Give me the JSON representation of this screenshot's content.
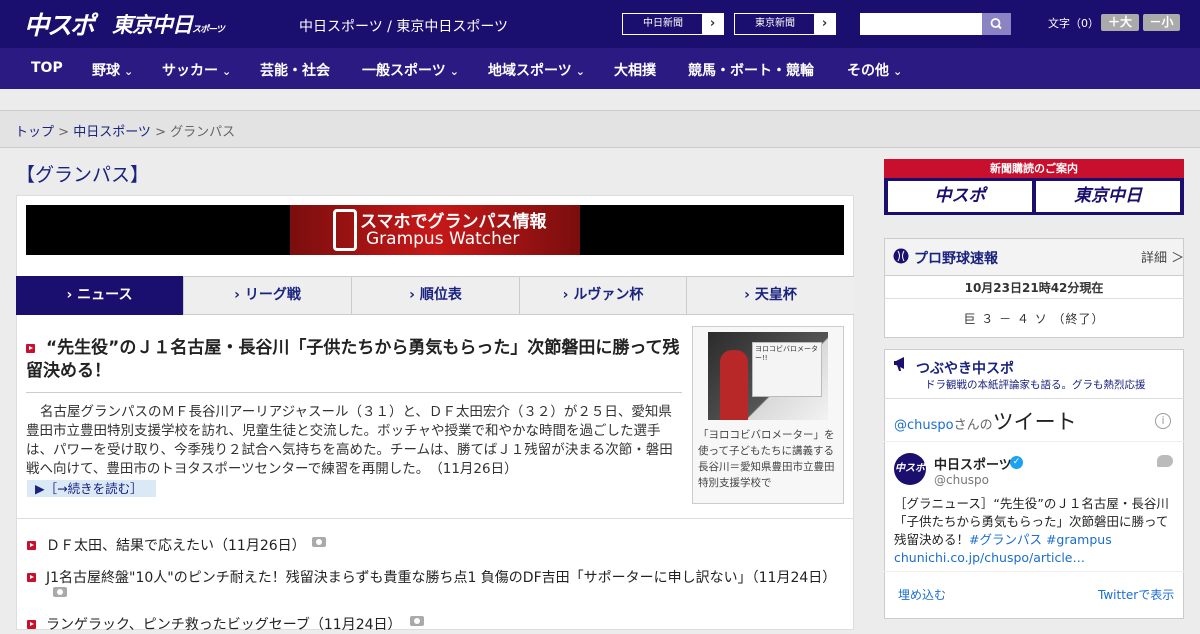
{
  "header": {
    "logo_left": "中スポ",
    "logo_right": "東京中日",
    "logo_right_small": "スポーツ",
    "site_name": "中日スポーツ / 東京中日スポーツ",
    "ext_links": [
      "中日新聞",
      "東京新聞"
    ],
    "search_placeholder": "",
    "font_size_label": "文字（0）",
    "font_bigger": "＋大",
    "font_smaller": "－小",
    "bg_color": "#1a0e6e",
    "nav_color": "#2a1a82"
  },
  "nav": {
    "items": [
      {
        "label": "TOP",
        "dropdown": false
      },
      {
        "label": "野球",
        "dropdown": true
      },
      {
        "label": "サッカー",
        "dropdown": true
      },
      {
        "label": "芸能・社会",
        "dropdown": false
      },
      {
        "label": "一般スポーツ",
        "dropdown": true
      },
      {
        "label": "地域スポーツ",
        "dropdown": true
      },
      {
        "label": "大相撲",
        "dropdown": false
      },
      {
        "label": "競馬・ボート・競輪",
        "dropdown": false
      },
      {
        "label": "その他",
        "dropdown": true
      }
    ],
    "chevron": "⌄"
  },
  "breadcrumb": {
    "items": [
      "トップ",
      "中日スポーツ",
      "グランパス"
    ],
    "separator": " > "
  },
  "page": {
    "title": "【グランパス】",
    "banner_line1": "スマホでグランパス情報",
    "banner_line2": "Grampus Watcher"
  },
  "tabs": [
    "ニュース",
    "リーグ戦",
    "順位表",
    "ルヴァン杯",
    "天皇杯"
  ],
  "tab_prefix": "› ",
  "article": {
    "headline": "“先生役”のＪ１名古屋・長谷川「子供たちから勇気もらった」次節磐田に勝って残留決める！",
    "body": "名古屋グランパスのＭＦ長谷川アーリアジャスール（３１）と、ＤＦ太田宏介（３２）が２５日、愛知県豊田市立豊田特別支援学校を訪れ、児童生徒と交流した。ボッチャや授業で和やかな時間を過ごした選手は、パワーを受け取り、今季残り２試合へ気持ちを高めた。チームは、勝てばＪ１残留が決まる次節・磐田戦へ向けて、豊田市のトヨタスポーツセンターで練習を再開した。　（11月26日）",
    "more": "▶［→続きを読む］",
    "photo_board_text": "ヨロコビバロメーター!!",
    "caption": "「ヨロコビバロメーター」を使って子どもたちに講義する長谷川＝愛知県豊田市立豊田特別支援学校で"
  },
  "news_list": [
    {
      "text": "ＤＦ太田、結果で応えたい（11月26日）",
      "camera": true
    },
    {
      "text": "J1名古屋終盤\"10人\"のピンチ耐えた！残留決まらずも貴重な勝ち点1 負傷のDF吉田「サポーターに申し訳ない」（11月24日）",
      "camera": true
    },
    {
      "text": "ランゲラック、ピンチ救ったビッグセーブ（11月24日）",
      "camera": true
    }
  ],
  "sidebar": {
    "subscribe_title": "新聞購読のご案内",
    "subscribe_buttons": [
      "中スポ",
      "東京中日"
    ],
    "baseball": {
      "title": "プロ野球速報",
      "detail": "詳細 ＞",
      "time": "10月23日21時42分現在",
      "score": "巨 ３ － ４ ソ （終了）"
    },
    "twitter": {
      "title": "つぶやき中スポ",
      "subtitle": "ドラ観戦の本紙評論家も語る。グラも熱烈応援",
      "handle_link": "@chuspo",
      "san": "さんの",
      "tweet_word": "ツイート",
      "info": "i",
      "avatar_text": "中スポ",
      "name": "中日スポーツ",
      "handle": "@chuspo",
      "verified": "✓",
      "text": "［グラニュース］“先生役”のＪ１名古屋・長谷川「子供たちから勇気もらった」次節磐田に勝って残留決める！",
      "hashtags": "#グランパス #grampus",
      "link": "chunichi.co.jp/chuspo/article…",
      "embed": "埋め込む",
      "view": "Twitterで表示"
    }
  }
}
